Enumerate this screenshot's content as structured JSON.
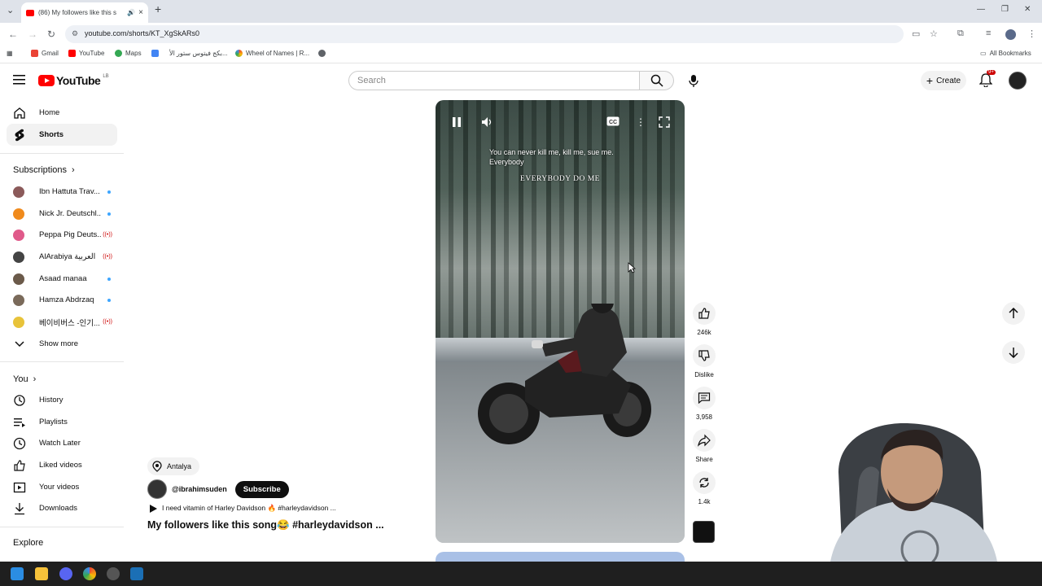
{
  "browser": {
    "tab_title": "(86) My followers like this s",
    "url": "youtube.com/shorts/KT_XgSkARs0",
    "bookmarks": [
      "Gmail",
      "YouTube",
      "Maps",
      "بكج فيتوس ستور الأ...",
      "Wheel of Names | R..."
    ],
    "all_bookmarks": "All Bookmarks"
  },
  "header": {
    "logo_text": "YouTube",
    "logo_region": "LB",
    "search_placeholder": "Search",
    "create_label": "Create",
    "notif_badge": "9+"
  },
  "sidebar": {
    "main": [
      {
        "label": "Home",
        "icon": "home-icon"
      },
      {
        "label": "Shorts",
        "icon": "shorts-icon",
        "active": true
      }
    ],
    "subscriptions_title": "Subscriptions",
    "subscriptions": [
      {
        "label": "Ibn Hattuta Trav...",
        "status": "new",
        "color": "#8b5a5a"
      },
      {
        "label": "Nick Jr. Deutschl...",
        "status": "new",
        "color": "#f08a1c"
      },
      {
        "label": "Peppa Pig Deuts...",
        "status": "live",
        "color": "#e05a8a"
      },
      {
        "label": "AlArabiya العربية",
        "status": "live",
        "color": "#444444"
      },
      {
        "label": "Asaad manaa",
        "status": "new",
        "color": "#6b5a4a"
      },
      {
        "label": "Hamza Abdrzaq",
        "status": "new",
        "color": "#7a6a5a"
      },
      {
        "label": "베이비버스 -인기...",
        "status": "live",
        "color": "#e8c33a"
      }
    ],
    "show_more": "Show more",
    "you_title": "You",
    "you_items": [
      {
        "label": "History",
        "icon": "history-icon"
      },
      {
        "label": "Playlists",
        "icon": "playlists-icon"
      },
      {
        "label": "Watch Later",
        "icon": "watch-later-icon"
      },
      {
        "label": "Liked videos",
        "icon": "like-icon"
      },
      {
        "label": "Your videos",
        "icon": "your-videos-icon"
      },
      {
        "label": "Downloads",
        "icon": "download-icon"
      }
    ],
    "explore_title": "Explore"
  },
  "video": {
    "caption_line1": "You can never kill me, kill me, sue me.",
    "caption_line2": "Everybody",
    "caption_big": "EVERYBODY DO ME"
  },
  "short": {
    "location": "Antalya",
    "channel": "@ibrahimsuden",
    "subscribe_label": "Subscribe",
    "music": "I need vitamin of Harley Davidson 🔥 #harleydavidson ...",
    "title": "My followers like this song😂 #harleydavidson ..."
  },
  "actions": {
    "likes": "246k",
    "dislike_label": "Dislike",
    "comments": "3,958",
    "share_label": "Share",
    "remix_count": "1.4k"
  }
}
